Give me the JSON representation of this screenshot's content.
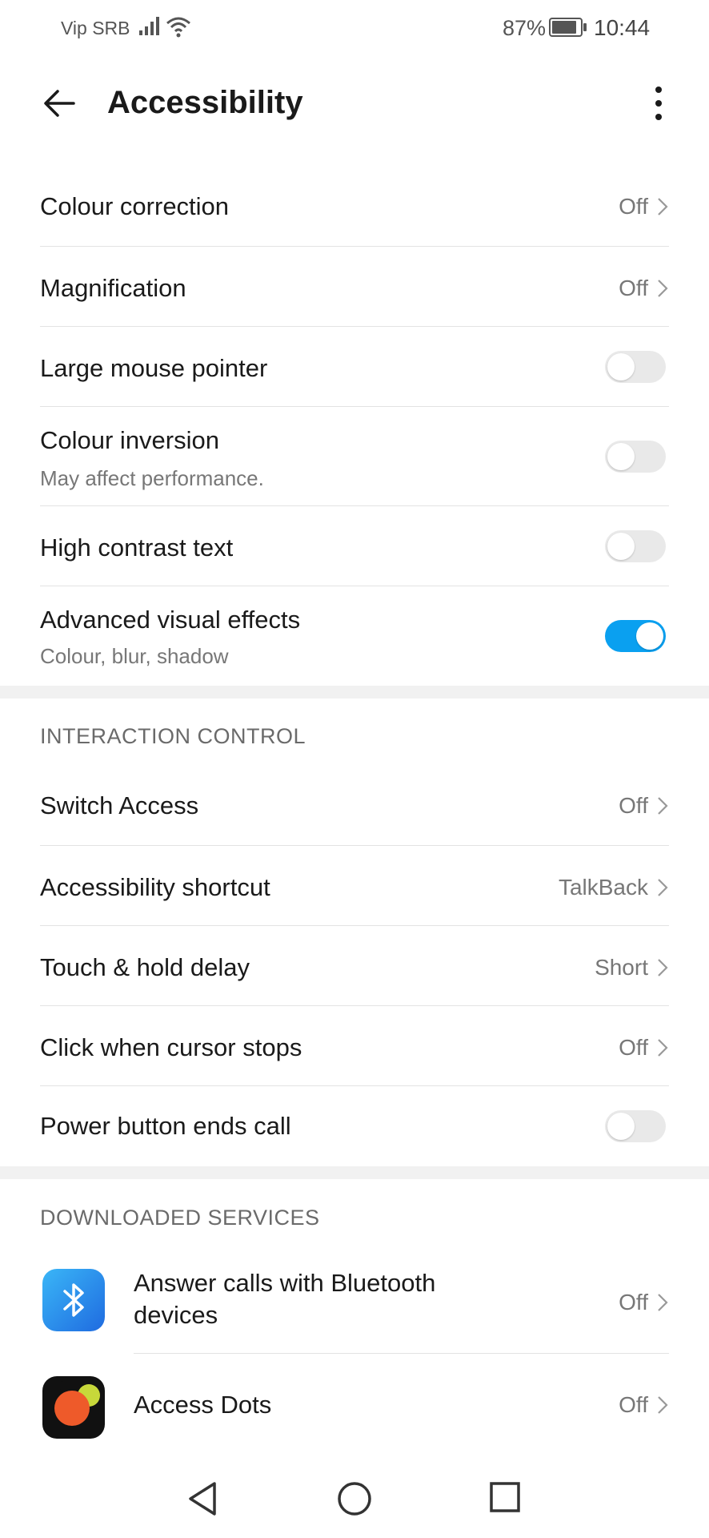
{
  "status_bar": {
    "carrier": "Vip SRB",
    "battery_percent": "87%",
    "time": "10:44",
    "battery_level": 0.87
  },
  "app_bar": {
    "title": "Accessibility",
    "back_icon": "back-arrow-icon",
    "more_icon": "more-vertical-icon"
  },
  "display_settings": [
    {
      "label": "Colour correction",
      "value": "Off",
      "type": "link"
    },
    {
      "label": "Magnification",
      "value": "Off",
      "type": "link"
    },
    {
      "label": "Large mouse pointer",
      "type": "toggle",
      "on": false
    },
    {
      "label": "Colour inversion",
      "subtitle": "May affect performance.",
      "type": "toggle",
      "on": false
    },
    {
      "label": "High contrast text",
      "type": "toggle",
      "on": false
    },
    {
      "label": "Advanced visual effects",
      "subtitle": "Colour, blur, shadow",
      "type": "toggle",
      "on": true
    }
  ],
  "interaction_control": {
    "header": "INTERACTION CONTROL",
    "items": [
      {
        "label": "Switch Access",
        "value": "Off",
        "type": "link"
      },
      {
        "label": "Accessibility shortcut",
        "value": "TalkBack",
        "type": "link"
      },
      {
        "label": "Touch & hold delay",
        "value": "Short",
        "type": "link"
      },
      {
        "label": "Click when cursor stops",
        "value": "Off",
        "type": "link"
      },
      {
        "label": "Power button ends call",
        "type": "toggle",
        "on": false
      }
    ]
  },
  "downloaded_services": {
    "header": "DOWNLOADED SERVICES",
    "items": [
      {
        "label_line1": "Answer calls with Bluetooth",
        "label_line2": "devices",
        "value": "Off",
        "icon": "bluetooth-icon"
      },
      {
        "label": "Access Dots",
        "value": "Off",
        "icon": "access-dots-icon"
      }
    ]
  },
  "nav_bar": {
    "back": "nav-back-icon",
    "home": "nav-home-icon",
    "recents": "nav-recents-icon"
  },
  "colors": {
    "accent": "#0aa0f0",
    "toggle_off": "#e9e9e9",
    "band": "#f1f1f1"
  }
}
